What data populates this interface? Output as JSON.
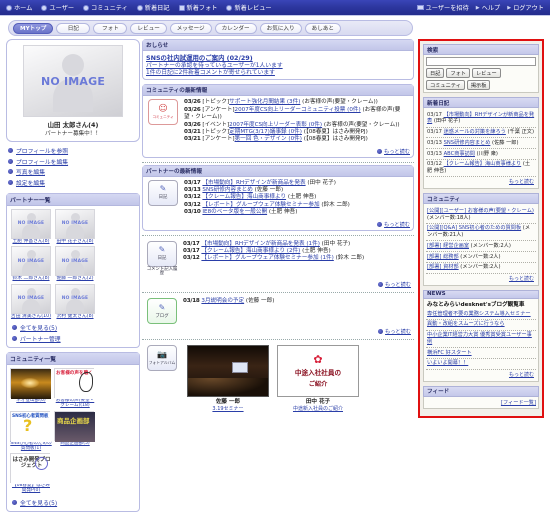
{
  "topnav": {
    "left_items": [
      {
        "label": "ホーム",
        "icon": "home-icon"
      },
      {
        "label": "ユーザー",
        "icon": "user-icon"
      },
      {
        "label": "コミュニティ",
        "icon": "community-icon"
      },
      {
        "label": "新着日記",
        "icon": "diary-icon"
      },
      {
        "label": "新着フォト",
        "icon": "photo-icon"
      },
      {
        "label": "新着レビュー",
        "icon": "review-icon"
      }
    ],
    "right_items": [
      {
        "label": "ユーザーを招待",
        "icon": "invite-card-icon"
      },
      {
        "label": "ヘルプ",
        "icon": "arrow-icon"
      },
      {
        "label": "ログアウト",
        "icon": "arrow-icon"
      }
    ]
  },
  "tabs": [
    {
      "label": "MYトップ",
      "active": true
    },
    {
      "label": "日記",
      "active": false
    },
    {
      "label": "フォト",
      "active": false
    },
    {
      "label": "レビュー",
      "active": false
    },
    {
      "label": "メッセージ",
      "active": false
    },
    {
      "label": "カレンダー",
      "active": false
    },
    {
      "label": "お気に入り",
      "active": false
    },
    {
      "label": "あしあと",
      "active": false
    }
  ],
  "profile": {
    "image_label": "NO IMAGE",
    "name": "山田 太郎さん(4)",
    "status": "パートナー募集中！！",
    "links": [
      "プロフィールを参照",
      "プロフィールを編集",
      "写真を編集",
      "設定を編集"
    ]
  },
  "partners": {
    "title": "パートナー一覧",
    "image_label": "NO IMAGE",
    "items": [
      {
        "name": "土肥 伸吾さん(8)"
      },
      {
        "name": "田中 花子さん(8)"
      },
      {
        "name": "鈴木 二郎さん(8)"
      },
      {
        "name": "佐藤 一郎さん(2)"
      },
      {
        "name": "吉田 清美さん(10)"
      },
      {
        "name": "沢村 健太さん(8)"
      }
    ],
    "footer_links": [
      "全てを見る(5)",
      "パートナー管理"
    ]
  },
  "communities_left": {
    "title": "コミュニティ一覧",
    "items": [
      {
        "name": "ネオ登山部(0)",
        "art": "sunset"
      },
      {
        "name": "お客様の声(要望・クレーム)(18)",
        "art": "ear",
        "art_text": "お客様の声を聴く"
      },
      {
        "name": "SNSが心者のための質問板(1)",
        "art": "sns",
        "art_text": "SNS初心者質問板"
      },
      {
        "name": "商品企画部(5)",
        "art": "plan",
        "art_text": "商品企画部"
      },
      {
        "name": "【08春夏】はさみ間発P(0)",
        "art": "proj",
        "art_text": "はさみ開発プロジェクト"
      }
    ],
    "footer_links": [
      "全てを見る(5)"
    ]
  },
  "announcement": {
    "title": "おしらせ",
    "headline": "SNSの社内試運用のご案内 (02/29)",
    "lines": [
      "パートナーの承認を待っているユーザーが1人います",
      "1件の日記に2件新着コメントが寄せられています"
    ]
  },
  "community_news": {
    "title": "コミュニティの最新情報",
    "badge_label": "コミュニティ",
    "items": [
      {
        "date": "03/26",
        "tag": "[トピック]",
        "link": "サポート強化月間結果 (3件)",
        "suffix": "(お客様の声(要望・クレーム))"
      },
      {
        "date": "03/26",
        "tag": "[アンケート]",
        "link": "2007年度CS向上リーダーコミュニティ投票 (0件)",
        "suffix": "(お客様の声(要望・クレーム))"
      },
      {
        "date": "03/26",
        "tag": "[イベント]",
        "link": "2007年度CS向上リーダー表彰 (0件)",
        "suffix": "(お客様の声(要望・クレーム))"
      },
      {
        "date": "03/21",
        "tag": "[トピック]",
        "link": "定期MTG(3/17)議事録 (0件)",
        "suffix": "(【08春夏】はさみ開発PJ)"
      },
      {
        "date": "03/21",
        "tag": "[アンケート]",
        "link": "第一回 色・デザイン (0件)",
        "suffix": "(【08春夏】はさみ開発PJ)"
      }
    ],
    "more_label": "もっと読む"
  },
  "partner_news": {
    "title": "パートナーの最新情報",
    "badge_label": "日記",
    "items": [
      {
        "date": "03/17",
        "link": "【市場動向】RHデザインが新商品を発表",
        "suffix": "(田中 花子)"
      },
      {
        "date": "03/13",
        "link": "SNS研修内容まとめ",
        "suffix": "(佐藤 一郎)"
      },
      {
        "date": "03/12",
        "link": "【クレーム報告】海山商事様より",
        "suffix": "(土肥 伸吾)"
      },
      {
        "date": "03/12",
        "link": "【レポート】グループウェア体験セミナー参加",
        "suffix": "(鈴木 二郎)"
      },
      {
        "date": "03/10",
        "link": "IE8のベータ版を一般公開",
        "suffix": "(土肥 伸吾)"
      }
    ],
    "more_label": "もっと読む"
  },
  "comment_news": {
    "badge_label": "日記",
    "badge_caption": "コメント記入履歴",
    "items": [
      {
        "date": "03/17",
        "link": "【市場動向】RHデザインが新商品を発表 (1件)",
        "suffix": "(田中 花子)"
      },
      {
        "date": "03/17",
        "link": "【クレーム報告】海山商事様より (2件)",
        "suffix": "(土肥 伸吾)"
      },
      {
        "date": "03/12",
        "link": "【レポート】グループウェア体験セミナー参加 (1件)",
        "suffix": "(鈴木 二郎)"
      }
    ],
    "more_label": "もっと読む"
  },
  "blog_news": {
    "badge_label": "ブログ",
    "items": [
      {
        "date": "03/18",
        "link": "3月説明会の予定",
        "suffix": "(佐藤 一郎)"
      }
    ],
    "more_label": "もっと読む"
  },
  "photo_album": {
    "badge_label": "フォトアルバム",
    "items": [
      {
        "name": "佐藤 一郎",
        "caption": "3.19セミナー",
        "art": "seminar"
      },
      {
        "name": "田中 花子",
        "caption": "中途新入社員のご紹介",
        "art": "intro",
        "art_line1": "中途入社社員の",
        "art_line2": "ご紹介"
      }
    ]
  },
  "search": {
    "title": "検索",
    "value": "",
    "placeholder": "",
    "buttons": [
      "日記",
      "フォト",
      "レビュー",
      "コミュニティ",
      "掲示板"
    ]
  },
  "new_diary": {
    "title": "新着日記",
    "items": [
      {
        "date": "03/17",
        "link": "【市場動向】RHデザインが新商品を発表",
        "suffix": "(田中 花子)"
      },
      {
        "date": "03/17",
        "link": "迷惑メールの対策を練ろう",
        "suffix": "(千葉 正文)"
      },
      {
        "date": "03/13",
        "link": "SNS研修内容まとめ",
        "suffix": "(佐藤 一郎)"
      },
      {
        "date": "03/13",
        "link": "ABC商事訪問",
        "suffix": "(川野 衆)"
      },
      {
        "date": "03/12",
        "link": "【クレーム報告】海山商事様より",
        "suffix": "(土肥 伸吾)"
      }
    ],
    "more_label": "もっと読む"
  },
  "communities_right": {
    "title": "コミュニティ",
    "items": [
      {
        "link": "[公開][ユーザー] お客様の声(要望・クレーム)",
        "suffix": "(メンバー数:18人)"
      },
      {
        "link": "[公開][Q&A] SNS初心者のための質問板",
        "suffix": "(メンバー数:21人)"
      },
      {
        "link": "[部署] 経営企画室",
        "suffix": "(メンバー数:2人)"
      },
      {
        "link": "[部署] 総務部",
        "suffix": "(メンバー数:2人)"
      },
      {
        "link": "[部署] 資材部",
        "suffix": "(メンバー数:2人)"
      }
    ],
    "more_label": "もっと読む"
  },
  "news": {
    "title": "NEWS",
    "lead": "みなとみらいdesknet'sブログ観覧車",
    "items": [
      "専任管理者不要の業務システム導入セミナー",
      "異動・改組をスムーズに行うなら",
      "中小企業IT経営力大賞 優秀賞受賞ユーザー事例",
      "横浜FC 好スタート",
      "いよいよ開幕！！"
    ],
    "more_label": "もっと読む"
  },
  "feed": {
    "title": "フィード",
    "link": "[フィード一覧]"
  }
}
